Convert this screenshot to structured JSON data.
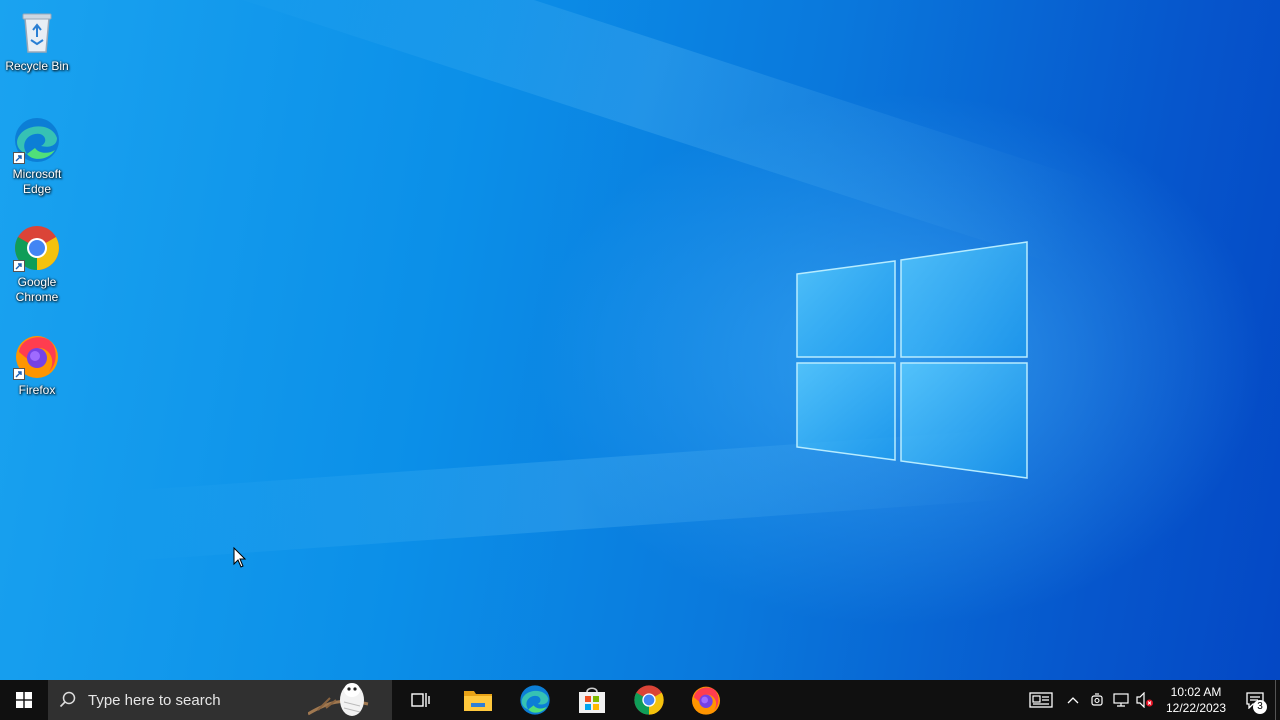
{
  "desktop": {
    "icons": [
      {
        "label": "Recycle Bin",
        "icon": "recycle-bin-icon",
        "shortcut": false
      },
      {
        "label": "Microsoft Edge",
        "icon": "edge-icon",
        "shortcut": true
      },
      {
        "label": "Google Chrome",
        "icon": "chrome-icon",
        "shortcut": true
      },
      {
        "label": "Firefox",
        "icon": "firefox-icon",
        "shortcut": true
      }
    ]
  },
  "taskbar": {
    "start_icon": "windows-logo-icon",
    "search": {
      "placeholder": "Type here to search"
    },
    "pinned": [
      {
        "name": "Task View",
        "icon": "task-view-icon"
      },
      {
        "name": "File Explorer",
        "icon": "file-explorer-icon"
      },
      {
        "name": "Microsoft Edge",
        "icon": "edge-icon"
      },
      {
        "name": "Microsoft Store",
        "icon": "store-icon"
      },
      {
        "name": "Google Chrome",
        "icon": "chrome-icon"
      },
      {
        "name": "Firefox",
        "icon": "firefox-icon"
      }
    ],
    "tray": {
      "clock_time": "10:02 AM",
      "clock_date": "12/22/2023",
      "notification_count": "3"
    }
  },
  "colors": {
    "taskbar": "#101010",
    "search_box": "#303030",
    "wallpaper_accent": "#0b8fe8"
  }
}
